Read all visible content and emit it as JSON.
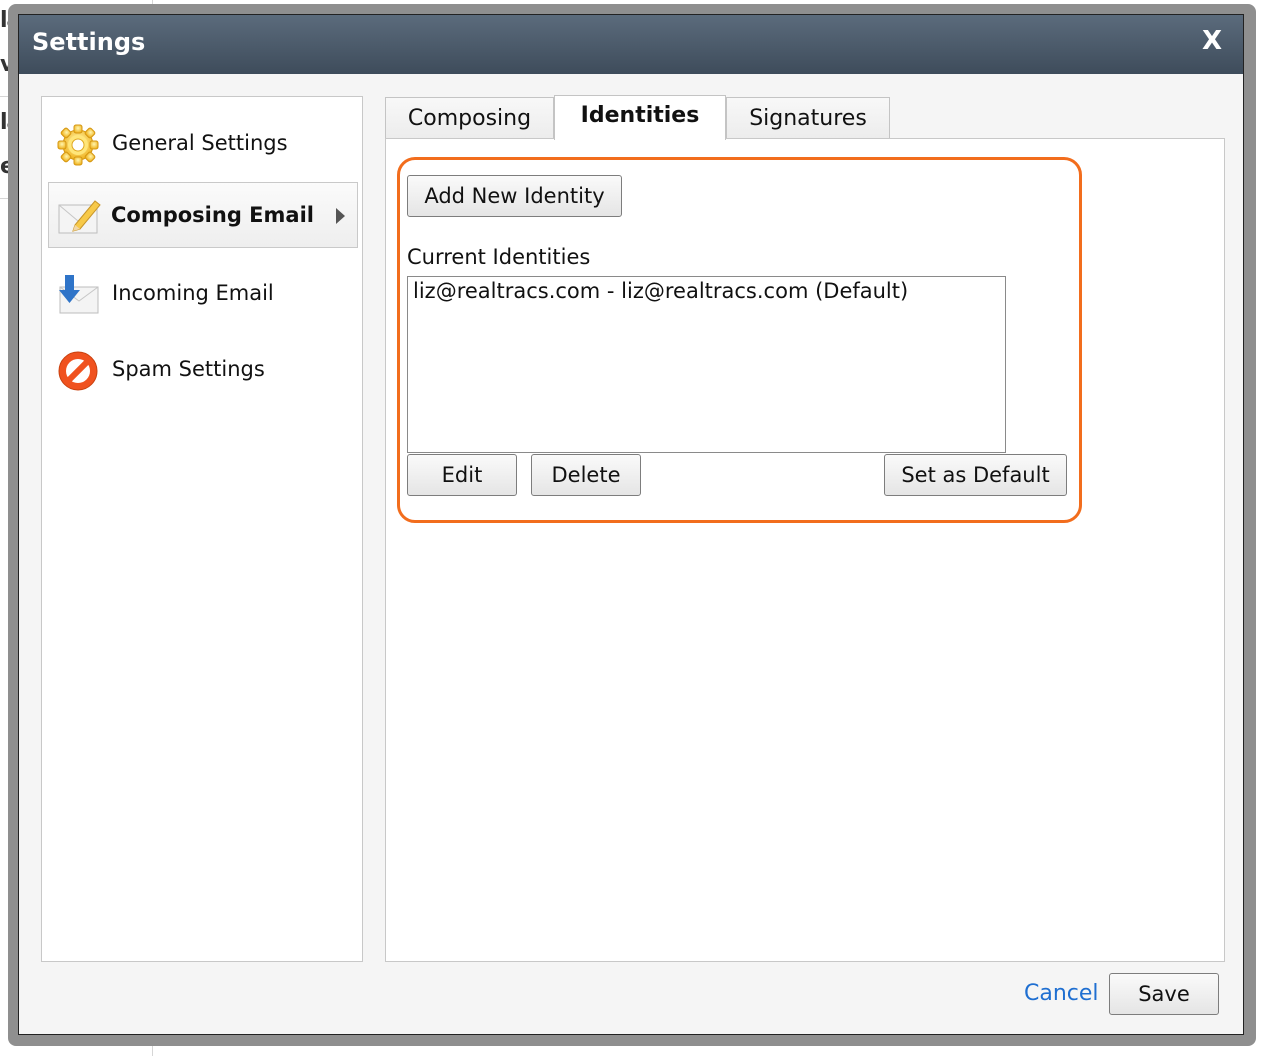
{
  "dialog": {
    "title": "Settings",
    "close_label": "X"
  },
  "background": {
    "fragments": [
      "la",
      "vo",
      "la",
      "eb"
    ]
  },
  "sidebar": {
    "items": [
      {
        "label": "General Settings",
        "icon": "gear-icon",
        "active": false
      },
      {
        "label": "Composing Email",
        "icon": "envelope-pencil-icon",
        "active": true
      },
      {
        "label": "Incoming Email",
        "icon": "envelope-download-icon",
        "active": false
      },
      {
        "label": "Spam Settings",
        "icon": "prohibited-icon",
        "active": false
      }
    ]
  },
  "tabs": [
    {
      "label": "Composing",
      "active": false
    },
    {
      "label": "Identities",
      "active": true
    },
    {
      "label": "Signatures",
      "active": false
    }
  ],
  "identities": {
    "add_button": "Add New Identity",
    "list_label": "Current Identities",
    "items": [
      "liz@realtracs.com - liz@realtracs.com (Default)"
    ],
    "edit_button": "Edit",
    "delete_button": "Delete",
    "default_button": "Set as Default"
  },
  "footer": {
    "cancel_label": "Cancel",
    "save_label": "Save"
  },
  "colors": {
    "titlebar": "#4a5969",
    "highlight": "#f26d1d",
    "link": "#1f6fd1"
  }
}
